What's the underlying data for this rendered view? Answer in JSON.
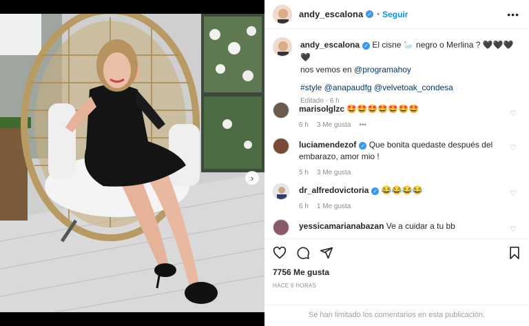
{
  "post": {
    "author": "andy_escalona",
    "follow_label": "Seguir",
    "more_label": "•••",
    "carousel_next": "›"
  },
  "caption": {
    "username": "andy_escalona",
    "text": "El cisne 🦢 negro o Merlina ? 🖤🖤🖤🖤",
    "line2_prefix": "nos vemos en ",
    "mention": "@programahoy",
    "tags": "#style @anapaudfg @velvetoak_condesa",
    "edited": "Editado · 6 h"
  },
  "comments": [
    {
      "username": "marisolglzc",
      "verified": false,
      "text": "🤩🤩🤩🤩🤩🤩🤩",
      "time": "6 h",
      "likes": "3 Me gusta",
      "extra": "•••"
    },
    {
      "username": "luciamendezof",
      "verified": true,
      "text": "Que bonita quedaste después del embarazo, amor mio !",
      "time": "5 h",
      "likes": "3 Me gusta",
      "extra": ""
    },
    {
      "username": "dr_alfredovictoria",
      "verified": true,
      "text": "😂😂😂😂",
      "time": "6 h",
      "likes": "1 Me gusta",
      "extra": ""
    },
    {
      "username": "yessicamarianabazan",
      "verified": false,
      "text": "Ve a cuidar a tu bb",
      "time": "",
      "likes": "",
      "extra": ""
    }
  ],
  "stats": {
    "likes": "7756 Me gusta",
    "ago": "HACE 6 HORAS"
  },
  "footer": {
    "notice": "Se han limitado los comentarios en esta publicación."
  },
  "colors": {
    "accent": "#0095f6",
    "verified": "#3897f0",
    "text": "#262626",
    "muted": "#8e8e8e"
  },
  "icons": [
    "heart-icon",
    "comment-icon",
    "share-icon",
    "bookmark-icon",
    "verified-icon",
    "more-icon",
    "chevron-right-icon"
  ]
}
